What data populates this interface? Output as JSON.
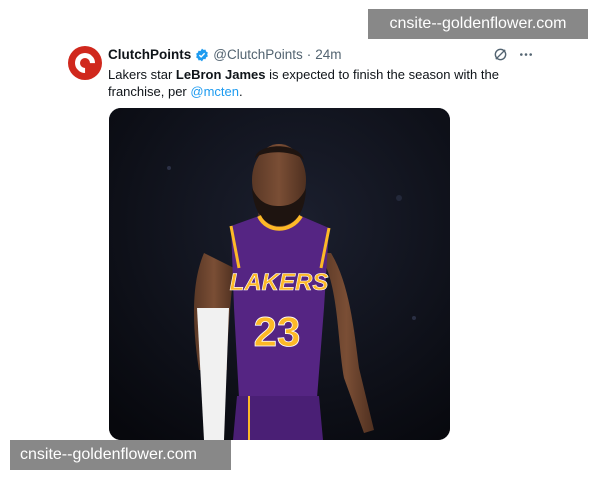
{
  "tweet": {
    "author_name": "ClutchPoints",
    "author_handle": "@ClutchPoints",
    "separator": "·",
    "time": "24m",
    "text_prefix": "Lakers star ",
    "text_bold": "LeBron James",
    "text_middle": " is expected to finish the season with the franchise, per ",
    "mention": "@mcten",
    "text_suffix": ".",
    "icons": [
      "clutchpoints-logo-icon",
      "verified-badge-icon",
      "grok-icon",
      "more-icon"
    ]
  },
  "media": {
    "jersey_wordmark": "LAKERS",
    "jersey_number": "23",
    "colors": {
      "jersey": "#552583",
      "trim": "#fdb927",
      "background": "#0a0b12"
    }
  },
  "watermarks": {
    "top": "cnsite--goldenflower.com",
    "bottom": "cnsite--goldenflower.com"
  },
  "colors": {
    "brand": "#d0281d",
    "link": "#1d9bf0",
    "verified": "#1d9bf0"
  }
}
